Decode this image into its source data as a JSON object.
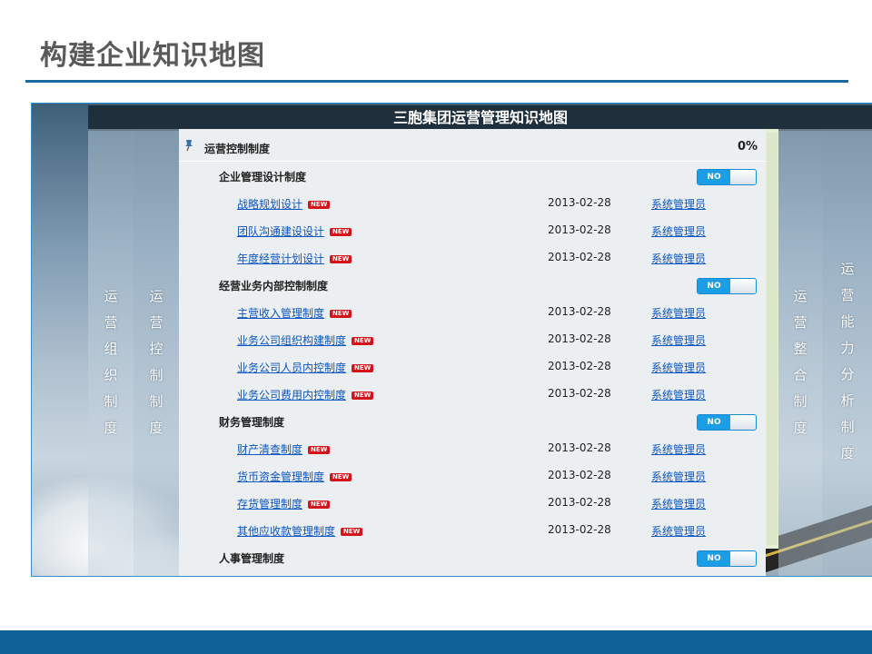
{
  "slide": {
    "title": "构建企业知识地图"
  },
  "header": {
    "title": "三胞集团运营管理知识地图"
  },
  "side_columns": {
    "left1": "运营组织制度",
    "left2": "运营控制制度",
    "right1": "运营整合制度",
    "right2": "运营能力分析制度"
  },
  "tree": {
    "root_label": "运营控制制度",
    "root_percent": "0%",
    "toggle_label": "NO",
    "new_badge": "NEW",
    "categories": [
      {
        "name": "企业管理设计制度",
        "items": [
          {
            "title": "战略规划设计",
            "date": "2013-02-28",
            "owner": "系统管理员"
          },
          {
            "title": "团队沟通建设设计",
            "date": "2013-02-28",
            "owner": "系统管理员"
          },
          {
            "title": "年度经营计划设计",
            "date": "2013-02-28",
            "owner": "系统管理员"
          }
        ]
      },
      {
        "name": "经营业务内部控制制度",
        "items": [
          {
            "title": "主营收入管理制度",
            "date": "2013-02-28",
            "owner": "系统管理员"
          },
          {
            "title": "业务公司组织构建制度",
            "date": "2013-02-28",
            "owner": "系统管理员"
          },
          {
            "title": "业务公司人员内控制度",
            "date": "2013-02-28",
            "owner": "系统管理员"
          },
          {
            "title": "业务公司费用内控制度",
            "date": "2013-02-28",
            "owner": "系统管理员"
          }
        ]
      },
      {
        "name": "财务管理制度",
        "items": [
          {
            "title": "财产清查制度",
            "date": "2013-02-28",
            "owner": "系统管理员"
          },
          {
            "title": "货币资金管理制度",
            "date": "2013-02-28",
            "owner": "系统管理员"
          },
          {
            "title": "存货管理制度",
            "date": "2013-02-28",
            "owner": "系统管理员"
          },
          {
            "title": "其他应收款管理制度",
            "date": "2013-02-28",
            "owner": "系统管理员"
          }
        ]
      },
      {
        "name": "人事管理制度",
        "items": []
      }
    ]
  }
}
